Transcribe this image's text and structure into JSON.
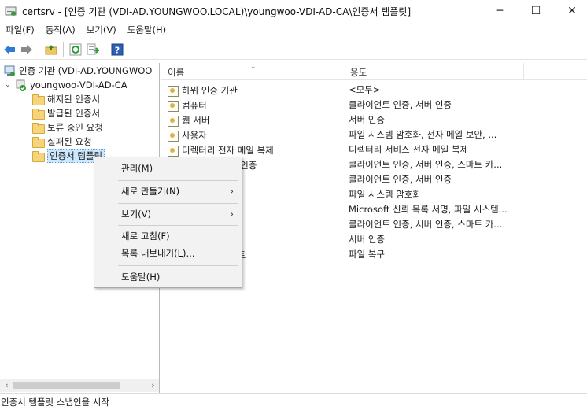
{
  "window": {
    "title": "certsrv - [인증 기관 (VDI-AD.YOUNGWOO.LOCAL)\\youngwoo-VDI-AD-CA\\인증서 템플릿]",
    "min_glyph": "─",
    "max_glyph": "☐",
    "close_glyph": "✕"
  },
  "menu": [
    "파일(F)",
    "동작(A)",
    "보기(V)",
    "도움말(H)"
  ],
  "toolbar": {
    "icons": [
      "back-icon",
      "forward-icon",
      "up-folder-icon",
      "refresh-icon",
      "export-list-icon",
      "help-icon"
    ]
  },
  "tree": {
    "root": "인증 기관 (VDI-AD.YOUNGWOO",
    "ca": "youngwoo-VDI-AD-CA",
    "folders": [
      "해지된 인증서",
      "발급된 인증서",
      "보류 중인 요청",
      "실패된 요청",
      "인증서 템플릿"
    ],
    "selected": "인증서 템플릿"
  },
  "list": {
    "columns": [
      "이름",
      "용도"
    ],
    "rows": [
      {
        "name": "하위 인증 기관",
        "purpose": "<모두>"
      },
      {
        "name": "컴퓨터",
        "purpose": "클라이언트 인증, 서버 인증"
      },
      {
        "name": "웹 서버",
        "purpose": "서버 인증"
      },
      {
        "name": "사용자",
        "purpose": "파일 시스템 암호화, 전자 메일 보안, ..."
      },
      {
        "name": "디렉터리 전자 메일 복제",
        "purpose": "디렉터리 서비스 전자 메일 복제"
      },
      {
        "name": "러 인증",
        "purpose": "클라이언트 인증, 서버 인증, 스마트 카..."
      },
      {
        "name": "러",
        "purpose": "클라이언트 인증, 서버 인증"
      },
      {
        "name": "",
        "purpose": "파일 시스템 암호화"
      },
      {
        "name": "",
        "purpose": "Microsoft 신뢰 목록 서명, 파일 시스템..."
      },
      {
        "name": "",
        "purpose": "클라이언트 인증, 서버 인증, 스마트 카..."
      },
      {
        "name": "",
        "purpose": "서버 인증"
      },
      {
        "name": "전트",
        "purpose": "파일 복구"
      }
    ]
  },
  "context_menu": {
    "manage": "관리(M)",
    "new": "새로 만들기(N)",
    "view": "보기(V)",
    "refresh": "새로 고침(F)",
    "export": "목록 내보내기(L)...",
    "help": "도움말(H)",
    "submenu_glyph": "›"
  },
  "status": "인증서 템플릿 스냅인을 시작"
}
